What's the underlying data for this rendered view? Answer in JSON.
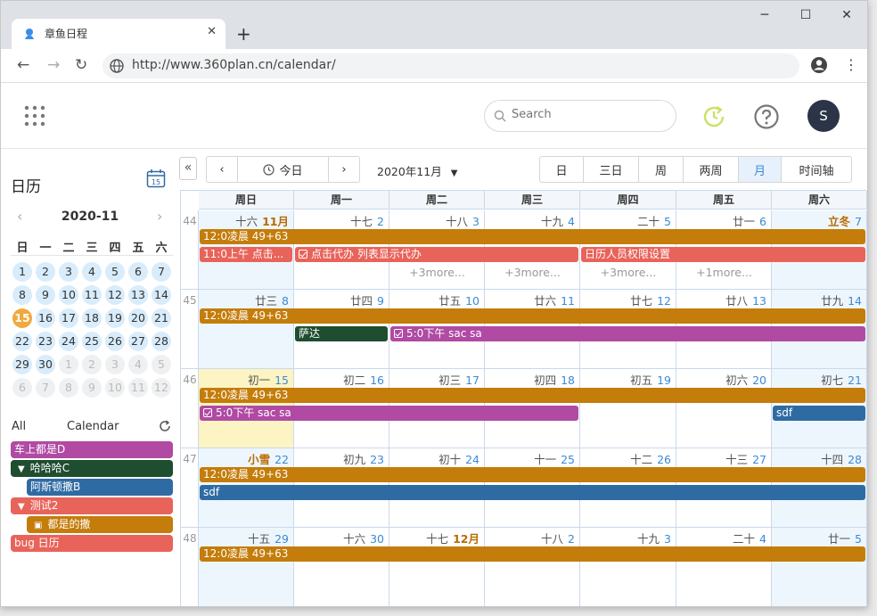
{
  "browser": {
    "tab_title": "章鱼日程",
    "url": "http://www.360plan.cn/calendar/"
  },
  "header": {
    "search_placeholder": "Search",
    "avatar_letter": "S"
  },
  "sidebar": {
    "title": "日历",
    "mini_month": "2020-11",
    "weekdays": [
      "日",
      "一",
      "二",
      "三",
      "四",
      "五",
      "六"
    ],
    "days": [
      [
        1,
        2,
        3,
        4,
        5,
        6,
        7
      ],
      [
        8,
        9,
        10,
        11,
        12,
        13,
        14
      ],
      [
        15,
        16,
        17,
        18,
        19,
        20,
        21
      ],
      [
        22,
        23,
        24,
        25,
        26,
        27,
        28
      ],
      [
        29,
        30,
        1,
        2,
        3,
        4,
        5
      ],
      [
        6,
        7,
        8,
        9,
        10,
        11,
        12
      ]
    ],
    "filter_all": "All",
    "filter_calendar": "Calendar",
    "calendars": [
      {
        "label": "车上都是D",
        "color": "#b04aa3",
        "prefix": ""
      },
      {
        "label": "哈哈哈C",
        "color": "#1e4d2f",
        "prefix": "▼"
      },
      {
        "label": "阿斯顿撒B",
        "color": "#2f6ba3",
        "prefix": ""
      },
      {
        "label": "测试2",
        "color": "#e8635a",
        "prefix": "▼"
      },
      {
        "label": "都是的撒",
        "color": "#c47c0a",
        "prefix": "▣"
      },
      {
        "label": "bug 日历",
        "color": "#e8635a",
        "prefix": ""
      }
    ]
  },
  "toolbar": {
    "today": "今日",
    "month_label": "2020年11月",
    "views": [
      "日",
      "三日",
      "周",
      "两周",
      "月",
      "时间轴"
    ],
    "active_view": "月"
  },
  "calendar": {
    "dow": [
      "周日",
      "周一",
      "周二",
      "周三",
      "周四",
      "周五",
      "周六"
    ],
    "weeks": [
      {
        "num": "44",
        "days": [
          {
            "lunar": "十六",
            "num": "11月",
            "month": true
          },
          {
            "lunar": "十七",
            "num": "2"
          },
          {
            "lunar": "十八",
            "num": "3"
          },
          {
            "lunar": "十九",
            "num": "4"
          },
          {
            "lunar": "二十",
            "num": "5"
          },
          {
            "lunar": "廿一",
            "num": "6"
          },
          {
            "lunar": "立冬",
            "num": "7",
            "term": true
          }
        ]
      },
      {
        "num": "45",
        "days": [
          {
            "lunar": "廿三",
            "num": "8"
          },
          {
            "lunar": "廿四",
            "num": "9"
          },
          {
            "lunar": "廿五",
            "num": "10"
          },
          {
            "lunar": "廿六",
            "num": "11"
          },
          {
            "lunar": "廿七",
            "num": "12"
          },
          {
            "lunar": "廿八",
            "num": "13"
          },
          {
            "lunar": "廿九",
            "num": "14"
          }
        ]
      },
      {
        "num": "46",
        "days": [
          {
            "lunar": "初一",
            "num": "15"
          },
          {
            "lunar": "初二",
            "num": "16"
          },
          {
            "lunar": "初三",
            "num": "17"
          },
          {
            "lunar": "初四",
            "num": "18"
          },
          {
            "lunar": "初五",
            "num": "19"
          },
          {
            "lunar": "初六",
            "num": "20"
          },
          {
            "lunar": "初七",
            "num": "21"
          }
        ]
      },
      {
        "num": "47",
        "days": [
          {
            "lunar": "小雪",
            "num": "22",
            "term": true
          },
          {
            "lunar": "初九",
            "num": "23"
          },
          {
            "lunar": "初十",
            "num": "24"
          },
          {
            "lunar": "十一",
            "num": "25"
          },
          {
            "lunar": "十二",
            "num": "26"
          },
          {
            "lunar": "十三",
            "num": "27"
          },
          {
            "lunar": "十四",
            "num": "28"
          }
        ]
      },
      {
        "num": "48",
        "days": [
          {
            "lunar": "十五",
            "num": "29"
          },
          {
            "lunar": "十六",
            "num": "30"
          },
          {
            "lunar": "十七",
            "num": "12月",
            "month": true
          },
          {
            "lunar": "十八",
            "num": "2"
          },
          {
            "lunar": "十九",
            "num": "3"
          },
          {
            "lunar": "二十",
            "num": "4"
          },
          {
            "lunar": "廿一",
            "num": "5"
          }
        ]
      }
    ],
    "events": [
      {
        "week": 0,
        "start": 0,
        "span": 7,
        "row": 0,
        "label": "12:0凌晨 49+63",
        "color": "#c47c0a",
        "check": false
      },
      {
        "week": 0,
        "start": 0,
        "span": 1,
        "row": 1,
        "label": "11:0上午 点击...",
        "color": "#e8635a",
        "check": false
      },
      {
        "week": 0,
        "start": 1,
        "span": 3,
        "row": 1,
        "label": "点击代办 列表显示代办",
        "color": "#e8635a",
        "check": true
      },
      {
        "week": 0,
        "start": 4,
        "span": 3,
        "row": 1,
        "label": "日历人员权限设置",
        "color": "#e8635a",
        "check": false
      },
      {
        "week": 1,
        "start": 0,
        "span": 7,
        "row": 0,
        "label": "12:0凌晨 49+63",
        "color": "#c47c0a",
        "check": false
      },
      {
        "week": 1,
        "start": 1,
        "span": 1,
        "row": 1,
        "label": "萨达",
        "color": "#1e4d2f",
        "check": false
      },
      {
        "week": 1,
        "start": 2,
        "span": 5,
        "row": 1,
        "label": "5:0下午 sac sa",
        "color": "#b04aa3",
        "check": true
      },
      {
        "week": 2,
        "start": 0,
        "span": 7,
        "row": 0,
        "label": "12:0凌晨 49+63",
        "color": "#c47c0a",
        "check": false
      },
      {
        "week": 2,
        "start": 0,
        "span": 4,
        "row": 1,
        "label": "5:0下午 sac sa",
        "color": "#b04aa3",
        "check": true
      },
      {
        "week": 2,
        "start": 6,
        "span": 1,
        "row": 1,
        "label": "sdf",
        "color": "#2f6ba3",
        "check": false
      },
      {
        "week": 3,
        "start": 0,
        "span": 7,
        "row": 0,
        "label": "12:0凌晨 49+63",
        "color": "#c47c0a",
        "check": false
      },
      {
        "week": 3,
        "start": 0,
        "span": 7,
        "row": 1,
        "label": "sdf",
        "color": "#2f6ba3",
        "check": false
      },
      {
        "week": 4,
        "start": 0,
        "span": 7,
        "row": 0,
        "label": "12:0凌晨 49+63",
        "color": "#c47c0a",
        "check": false
      }
    ],
    "more": [
      {
        "week": 0,
        "day": 2,
        "label": "+3more..."
      },
      {
        "week": 0,
        "day": 3,
        "label": "+3more..."
      },
      {
        "week": 0,
        "day": 4,
        "label": "+3more..."
      },
      {
        "week": 0,
        "day": 5,
        "label": "+1more..."
      }
    ]
  }
}
